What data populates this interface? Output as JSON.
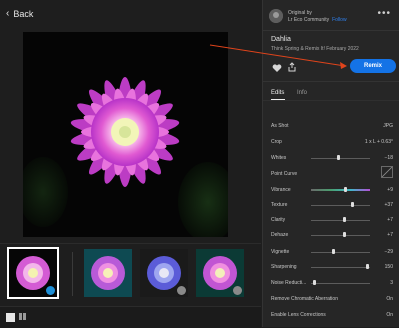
{
  "nav": {
    "back_label": "Back"
  },
  "post": {
    "original_by": "Original by",
    "author": "Lr Eco Community",
    "follow": "Follow",
    "title": "Dahlia",
    "subtitle": "Think Spring & Remix It! February 2022",
    "remix_label": "Remix"
  },
  "tabs": [
    {
      "label": "Edits"
    },
    {
      "label": "Info"
    }
  ],
  "edits": {
    "as_shot": {
      "label": "As Shot",
      "value": "JPG"
    },
    "crop": {
      "label": "Crop",
      "value": "1 x L + 0.63°"
    },
    "whites": {
      "label": "Whites",
      "value": "−18",
      "level": -18
    },
    "point_curve": {
      "label": "Point Curve"
    },
    "vibrance": {
      "label": "Vibrance",
      "value": "+9",
      "level": 9
    },
    "texture": {
      "label": "Texture",
      "value": "+37",
      "level": 37
    },
    "clarity": {
      "label": "Clarity",
      "value": "+7",
      "level": 7
    },
    "dehaze": {
      "label": "Dehaze",
      "value": "+7",
      "level": 7
    },
    "vignette": {
      "label": "Vignette",
      "value": "−29",
      "level": -29
    },
    "sharpening": {
      "label": "Sharpening",
      "value": "150",
      "level": 150
    },
    "noise": {
      "label": "Noise Reducti...",
      "value": "3",
      "level": 3
    },
    "chromatic": {
      "label": "Remove Chromatic Aberration",
      "value": "On"
    },
    "lens": {
      "label": "Enable Lens Corrections",
      "value": "On"
    }
  },
  "colors": {
    "accent": "#1473e6",
    "annotation_arrow": "#e0441b"
  }
}
